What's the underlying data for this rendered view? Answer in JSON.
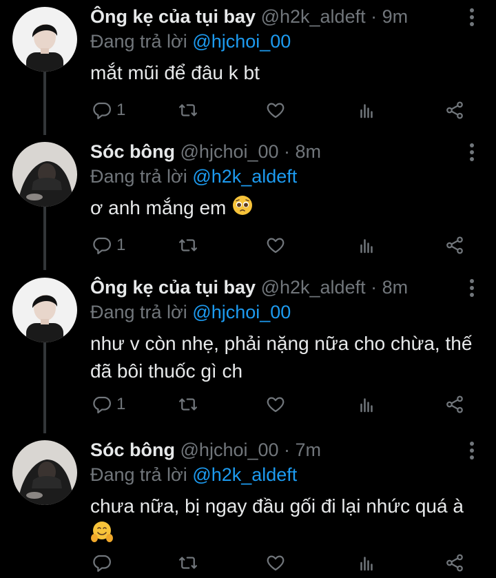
{
  "tweets": [
    {
      "display_name": "Ông kẹ của tụi bay",
      "handle": "@h2k_aldeft",
      "time": "· 9m",
      "replying_prefix": "Đang trả lời",
      "replying_to": "@hjchoi_00",
      "text": "mắt mũi để đâu k bt",
      "emoji": "",
      "reply_count": "1",
      "avatar": "avatar-boy-white-shirt"
    },
    {
      "display_name": "Sóc bông",
      "handle": "@hjchoi_00",
      "time": "· 8m",
      "replying_prefix": "Đang trả lời",
      "replying_to": "@h2k_aldeft",
      "text": "ơ anh mắng em",
      "emoji": "pleading-face",
      "reply_count": "1",
      "avatar": "avatar-hooded-person"
    },
    {
      "display_name": "Ông kẹ của tụi bay",
      "handle": "@h2k_aldeft",
      "time": "· 8m",
      "replying_prefix": "Đang trả lời",
      "replying_to": "@hjchoi_00",
      "text": "như v còn nhẹ, phải nặng nữa cho chừa, thế đã bôi thuốc gì ch",
      "emoji": "",
      "reply_count": "1",
      "avatar": "avatar-boy-white-shirt"
    },
    {
      "display_name": "Sóc bông",
      "handle": "@hjchoi_00",
      "time": "· 7m",
      "replying_prefix": "Đang trả lời",
      "replying_to": "@h2k_aldeft",
      "text": "chưa nữa, bị ngay đầu gối đi lại nhức quá à",
      "emoji": "hugging-face",
      "reply_count": "",
      "avatar": "avatar-hooded-person"
    }
  ],
  "icons": {
    "reply": "reply-icon",
    "retweet": "retweet-icon",
    "like": "like-icon",
    "analytics": "analytics-icon",
    "share": "share-icon",
    "more": "more-options-icon"
  },
  "colors": {
    "background": "#000000",
    "text": "#e7e9ea",
    "secondary": "#71767b",
    "mention": "#1d9bf0"
  }
}
